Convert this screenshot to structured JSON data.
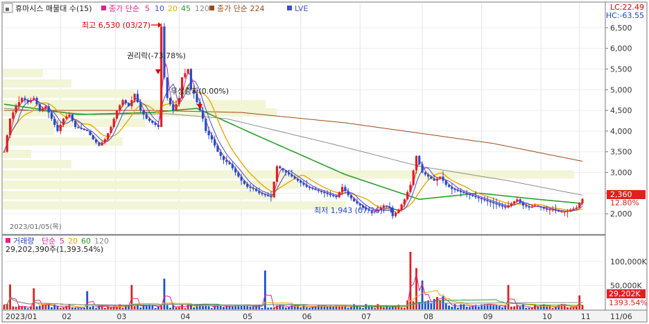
{
  "legend": {
    "stock": "휴마시스 매물대 수(15)",
    "ma_label": "종가 단순",
    "ma_periods": [
      "5",
      "10",
      "20",
      "45",
      "120"
    ],
    "ma_colors": [
      "#e0218a",
      "#3f4fcf",
      "#f0a500",
      "#2a9d2a",
      "#8c8c8c"
    ],
    "long_ma_label": "종가 단순 224",
    "long_ma_color": "#9a4a1c",
    "lve": "LVE",
    "vol_label": "거래량",
    "vol_ma_label": "단순",
    "vol_ma_periods": [
      "5",
      "20",
      "60",
      "120"
    ],
    "vol_ma_colors": [
      "#e0218a",
      "#f0a500",
      "#2a9d2a",
      "#8c8c8c"
    ],
    "vol_value": "29,202,390주(1,393.54%)"
  },
  "readouts": {
    "lc": "LC:22.49",
    "hc": "HC:-63.55"
  },
  "price_badge": {
    "value": "2,360",
    "pct": "12.80%"
  },
  "vol_badge": {
    "value": "29,202K",
    "pct": "1393.54%"
  },
  "annotations": {
    "high": "최고 6,530 (03/27)",
    "low": "최저 1,943 (07/26)",
    "rights": "권리락(-73.78%)",
    "bonus": "무상증자(0.00%)",
    "date": "2023/01/05(목)",
    "last_date": "11/06"
  },
  "chart_data": {
    "type": "candlestick",
    "price_ylim": [
      1600,
      6700
    ],
    "price_ticks": [
      "2,000",
      "2,500",
      "3,000",
      "3,500",
      "4,000",
      "4,500",
      "5,000",
      "5,500",
      "6,000",
      "6,500"
    ],
    "volume_ticks": [
      "50,000K",
      "100,000K"
    ],
    "volume_ylim": [
      0,
      130000
    ],
    "months": [
      "2023/01",
      "02",
      "03",
      "04",
      "05",
      "06",
      "07",
      "08",
      "09",
      "10",
      "11"
    ],
    "price_path": [
      [
        0,
        3500
      ],
      [
        4,
        4300
      ],
      [
        8,
        4600
      ],
      [
        12,
        4800
      ],
      [
        16,
        4700
      ],
      [
        20,
        4800
      ],
      [
        24,
        4500
      ],
      [
        28,
        4600
      ],
      [
        32,
        4300
      ],
      [
        36,
        4000
      ],
      [
        40,
        4300
      ],
      [
        44,
        4400
      ],
      [
        48,
        4100
      ],
      [
        52,
        4050
      ],
      [
        56,
        4000
      ],
      [
        60,
        3800
      ],
      [
        64,
        3650
      ],
      [
        68,
        3800
      ],
      [
        72,
        4100
      ],
      [
        76,
        4500
      ],
      [
        80,
        4750
      ],
      [
        84,
        4600
      ],
      [
        88,
        4900
      ],
      [
        92,
        4500
      ],
      [
        96,
        4300
      ],
      [
        100,
        4200
      ],
      [
        104,
        4100
      ],
      [
        106,
        6530
      ],
      [
        108,
        5300
      ],
      [
        110,
        4800
      ],
      [
        114,
        4500
      ],
      [
        118,
        4800
      ],
      [
        120,
        5300
      ],
      [
        124,
        5500
      ],
      [
        126,
        5000
      ],
      [
        128,
        4900
      ],
      [
        130,
        4700
      ],
      [
        134,
        4300
      ],
      [
        136,
        4000
      ],
      [
        140,
        3800
      ],
      [
        144,
        3500
      ],
      [
        148,
        3300
      ],
      [
        152,
        3200
      ],
      [
        156,
        3000
      ],
      [
        160,
        2800
      ],
      [
        164,
        2650
      ],
      [
        168,
        2600
      ],
      [
        172,
        2500
      ],
      [
        176,
        2450
      ],
      [
        180,
        2400
      ],
      [
        184,
        3150
      ],
      [
        188,
        3050
      ],
      [
        192,
        2950
      ],
      [
        196,
        2850
      ],
      [
        200,
        2750
      ],
      [
        204,
        2650
      ],
      [
        208,
        2600
      ],
      [
        212,
        2550
      ],
      [
        216,
        2500
      ],
      [
        220,
        2450
      ],
      [
        224,
        2400
      ],
      [
        228,
        2650
      ],
      [
        232,
        2450
      ],
      [
        236,
        2300
      ],
      [
        240,
        2200
      ],
      [
        244,
        2100
      ],
      [
        248,
        2050
      ],
      [
        252,
        2100
      ],
      [
        256,
        2200
      ],
      [
        260,
        2150
      ],
      [
        262,
        1943
      ],
      [
        266,
        2100
      ],
      [
        270,
        2350
      ],
      [
        274,
        2700
      ],
      [
        278,
        3400
      ],
      [
        282,
        3000
      ],
      [
        286,
        2900
      ],
      [
        290,
        2800
      ],
      [
        294,
        2900
      ],
      [
        298,
        2700
      ],
      [
        302,
        2600
      ],
      [
        306,
        2550
      ],
      [
        310,
        2500
      ],
      [
        314,
        2450
      ],
      [
        318,
        2400
      ],
      [
        322,
        2350
      ],
      [
        326,
        2300
      ],
      [
        330,
        2250
      ],
      [
        334,
        2200
      ],
      [
        338,
        2150
      ],
      [
        342,
        2250
      ],
      [
        346,
        2350
      ],
      [
        350,
        2200
      ],
      [
        354,
        2150
      ],
      [
        358,
        2200
      ],
      [
        362,
        2150
      ],
      [
        366,
        2100
      ],
      [
        370,
        2100
      ],
      [
        374,
        2050
      ],
      [
        378,
        2050
      ],
      [
        382,
        2100
      ],
      [
        386,
        2150
      ],
      [
        390,
        2360
      ]
    ],
    "ma224": [
      [
        0,
        4500
      ],
      [
        100,
        4500
      ],
      [
        160,
        4450
      ],
      [
        230,
        4200
      ],
      [
        280,
        3950
      ],
      [
        330,
        3700
      ],
      [
        390,
        3270
      ]
    ],
    "ma120": [
      [
        0,
        4550
      ],
      [
        60,
        4400
      ],
      [
        110,
        4420
      ],
      [
        150,
        4300
      ],
      [
        220,
        3700
      ],
      [
        280,
        3150
      ],
      [
        340,
        2800
      ],
      [
        390,
        2450
      ]
    ],
    "ma45": [
      [
        0,
        4650
      ],
      [
        50,
        4400
      ],
      [
        100,
        4450
      ],
      [
        130,
        4550
      ],
      [
        170,
        3900
      ],
      [
        230,
        2950
      ],
      [
        280,
        2350
      ],
      [
        320,
        2500
      ],
      [
        360,
        2350
      ],
      [
        390,
        2250
      ]
    ],
    "volume_spikes": [
      [
        4,
        52000
      ],
      [
        20,
        44000
      ],
      [
        56,
        38000
      ],
      [
        86,
        51000
      ],
      [
        108,
        64000
      ],
      [
        176,
        81000
      ],
      [
        274,
        120000
      ],
      [
        278,
        86000
      ],
      [
        282,
        60000
      ],
      [
        340,
        51000
      ],
      [
        388,
        29202
      ]
    ],
    "volume_profile": [
      {
        "price": 5400,
        "len": 0.07
      },
      {
        "price": 5150,
        "len": 0.12
      },
      {
        "price": 4900,
        "len": 0.23
      },
      {
        "price": 4650,
        "len": 0.46
      },
      {
        "price": 4450,
        "len": 0.48
      },
      {
        "price": 4200,
        "len": 0.25
      },
      {
        "price": 4000,
        "len": 0.09
      },
      {
        "price": 3750,
        "len": 0.21
      },
      {
        "price": 3450,
        "len": 0.05
      },
      {
        "price": 3200,
        "len": 0.12
      },
      {
        "price": 2950,
        "len": 1.0
      },
      {
        "price": 2700,
        "len": 0.52
      },
      {
        "price": 2450,
        "len": 0.48
      },
      {
        "price": 2200,
        "len": 0.6
      }
    ]
  }
}
